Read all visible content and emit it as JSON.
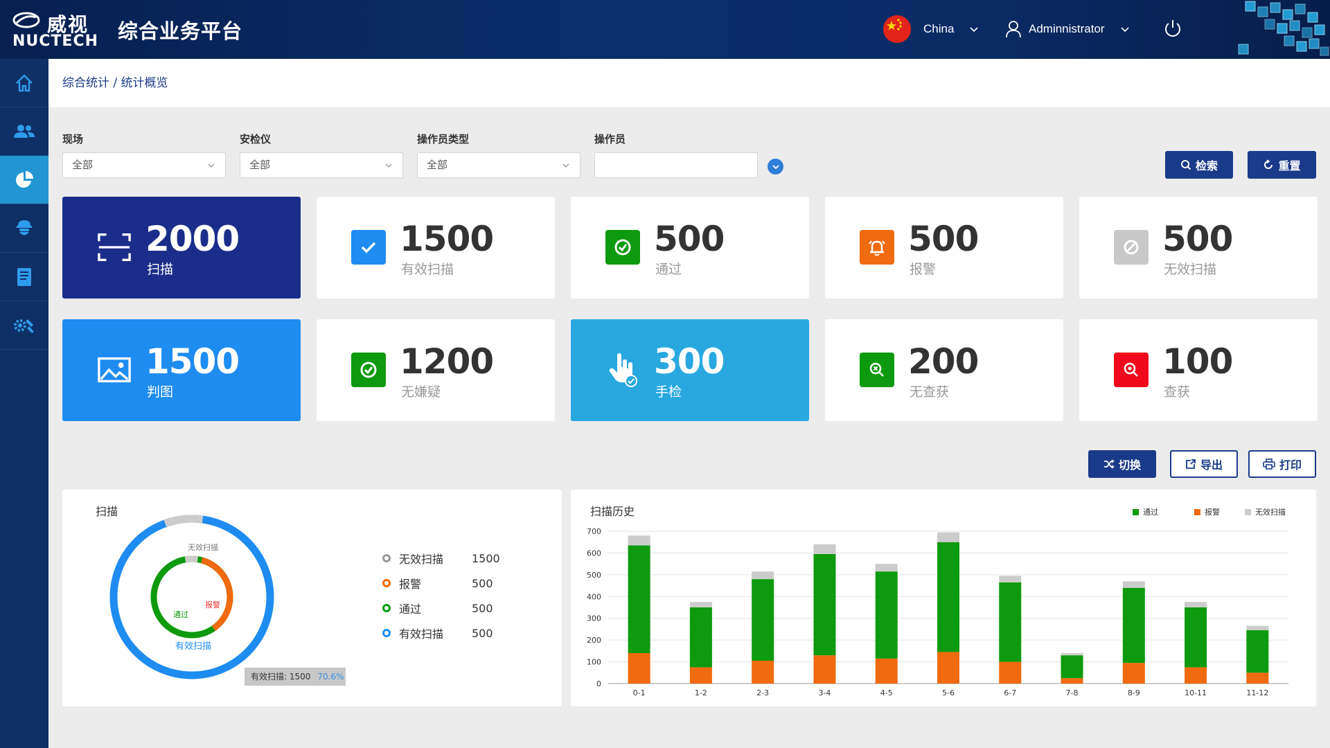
{
  "header": {
    "logo_cn": "威视",
    "logo_en": "NUCTECH",
    "app_title": "综合业务平台",
    "region": "China",
    "user": "Adminnistrator"
  },
  "sidebar": {
    "items": [
      {
        "icon": "home-icon"
      },
      {
        "icon": "users-icon"
      },
      {
        "icon": "pie-chart-icon",
        "active": true
      },
      {
        "icon": "inspector-icon"
      },
      {
        "icon": "book-icon"
      },
      {
        "icon": "settings-icon"
      }
    ]
  },
  "breadcrumb": "综合统计 / 统计概览",
  "filters": {
    "site": {
      "label": "现场",
      "value": "全部"
    },
    "device": {
      "label": "安检仪",
      "value": "全部"
    },
    "operator_type": {
      "label": "操作员类型",
      "value": "全部"
    },
    "operator": {
      "label": "操作员",
      "value": ""
    },
    "search_label": "检索",
    "reset_label": "重置"
  },
  "stats": [
    {
      "value": "2000",
      "label": "扫描",
      "icon": "scan-icon"
    },
    {
      "value": "1500",
      "label": "有效扫描",
      "icon": "checkbox-icon"
    },
    {
      "value": "500",
      "label": "通过",
      "icon": "check-circle-icon"
    },
    {
      "value": "500",
      "label": "报警",
      "icon": "alarm-bell-icon"
    },
    {
      "value": "500",
      "label": "无效扫描",
      "icon": "forbidden-icon"
    },
    {
      "value": "1500",
      "label": "判图",
      "icon": "image-icon"
    },
    {
      "value": "1200",
      "label": "无嫌疑",
      "icon": "check-circle-icon"
    },
    {
      "value": "300",
      "label": "手检",
      "icon": "hand-check-icon"
    },
    {
      "value": "200",
      "label": "无查获",
      "icon": "search-x-icon"
    },
    {
      "value": "100",
      "label": "查获",
      "icon": "search-found-icon"
    }
  ],
  "actions": {
    "switch_label": "切换",
    "export_label": "导出",
    "print_label": "打印"
  },
  "scan_panel": {
    "title": "扫描",
    "outer_ring_labels": {
      "invalid": "无效扫描",
      "valid": "有效扫描"
    },
    "inner_ring_labels": {
      "alarm": "报警",
      "pass": "通过"
    },
    "tooltip_text": "有效扫描: 1500",
    "tooltip_pct": "70.6%",
    "legend": [
      {
        "name": "无效扫描",
        "value": "1500",
        "color": "#999999"
      },
      {
        "name": "报警",
        "value": "500",
        "color": "#f06a0f"
      },
      {
        "name": "通过",
        "value": "500",
        "color": "#0e9a0e"
      },
      {
        "name": "有效扫描",
        "value": "500",
        "color": "#1e8cf0"
      }
    ]
  },
  "chart_data": {
    "type": "bar",
    "title": "扫描历史",
    "stacked": true,
    "categories": [
      "0-1",
      "1-2",
      "2-3",
      "3-4",
      "4-5",
      "5-6",
      "6-7",
      "7-8",
      "8-9",
      "10-11",
      "11-12"
    ],
    "series": [
      {
        "name": "通过",
        "color": "#0e9a0e",
        "values": [
          495,
          275,
          375,
          465,
          400,
          505,
          365,
          105,
          345,
          275,
          195
        ]
      },
      {
        "name": "报警",
        "color": "#f06a0f",
        "values": [
          140,
          75,
          105,
          130,
          115,
          145,
          100,
          25,
          95,
          75,
          50
        ]
      },
      {
        "name": "无效扫描",
        "color": "#cccccc",
        "values": [
          45,
          25,
          35,
          45,
          35,
          45,
          30,
          10,
          30,
          25,
          20
        ]
      }
    ],
    "ylim": [
      0,
      700
    ],
    "yticks": [
      0,
      100,
      200,
      300,
      400,
      500,
      600,
      700
    ],
    "legend_position": "top-right"
  }
}
